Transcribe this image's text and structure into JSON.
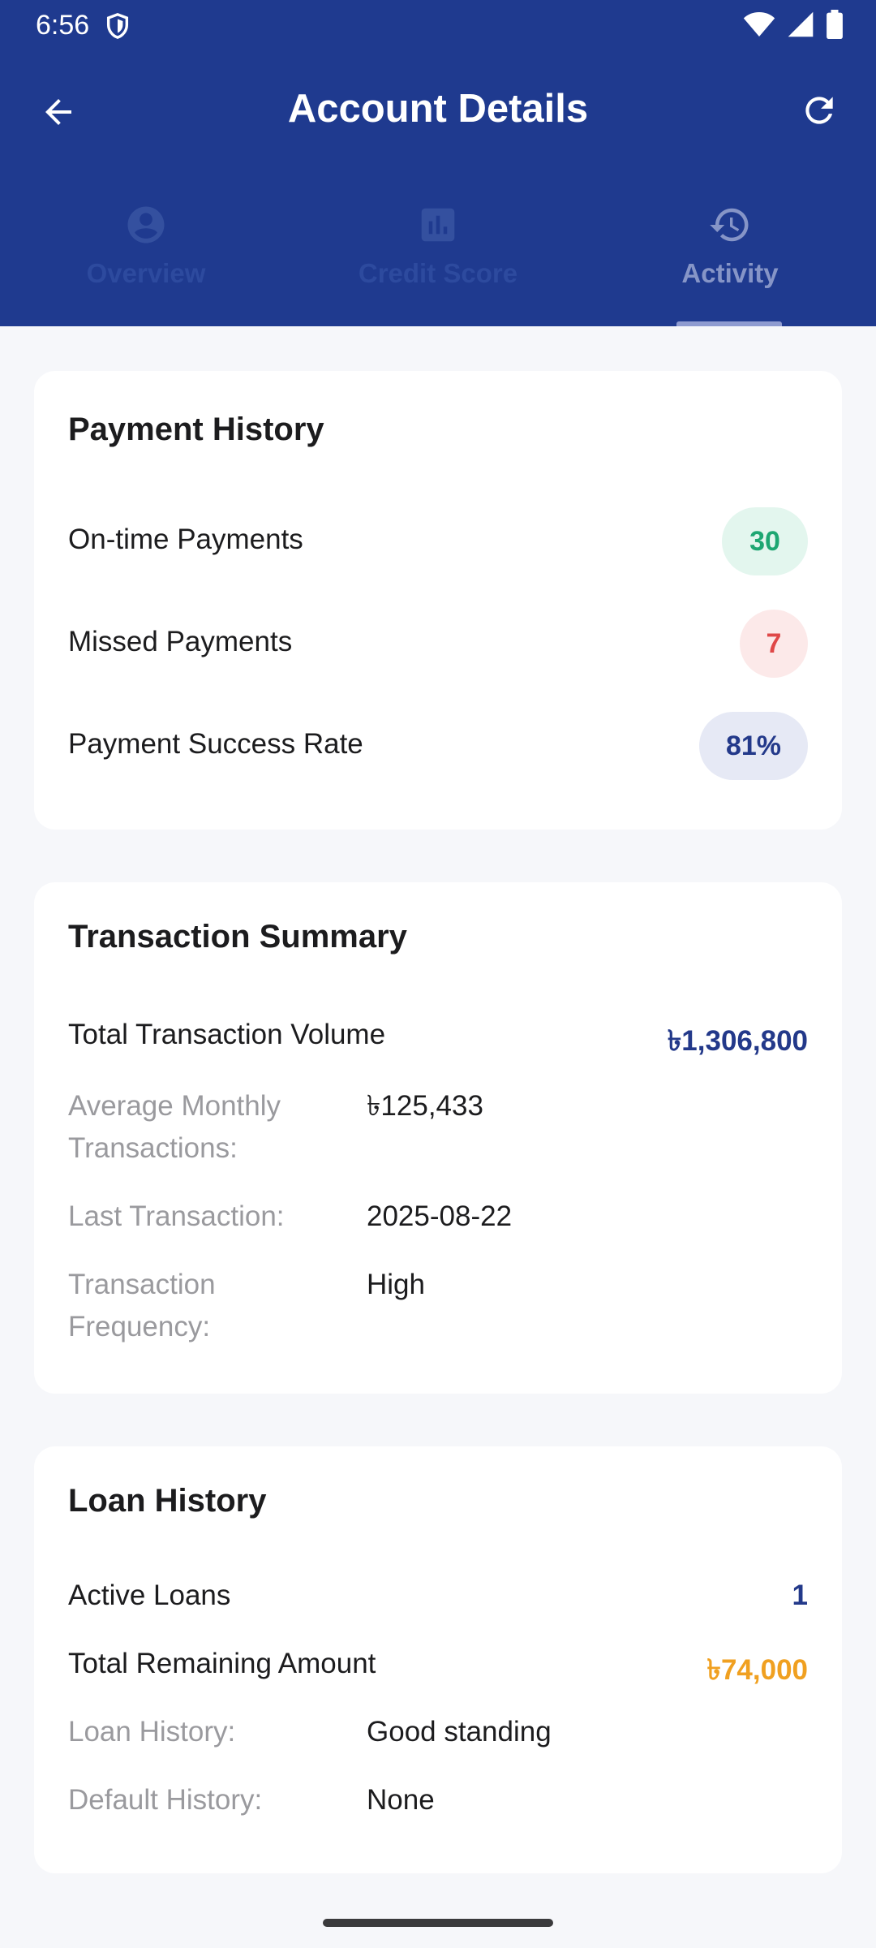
{
  "status_bar": {
    "time": "6:56",
    "icons": [
      "shield-icon",
      "wifi-icon",
      "signal-icon",
      "battery-icon"
    ]
  },
  "header": {
    "title": "Account Details",
    "back_icon": "arrow-back-icon",
    "refresh_icon": "refresh-icon",
    "background_color": "#1f3a8f"
  },
  "tabs": [
    {
      "label": "Overview",
      "icon": "account-circle-icon",
      "active": false
    },
    {
      "label": "Credit Score",
      "icon": "bar-chart-icon",
      "active": false
    },
    {
      "label": "Activity",
      "icon": "history-icon",
      "active": true
    }
  ],
  "payment_history": {
    "title": "Payment History",
    "rows": [
      {
        "label": "On-time Payments",
        "value": "30",
        "color": "#1ea672"
      },
      {
        "label": "Missed Payments",
        "value": "7",
        "color": "#df4848"
      },
      {
        "label": "Payment Success Rate",
        "value": "81%",
        "color": "#23398a"
      }
    ]
  },
  "transaction_summary": {
    "title": "Transaction Summary",
    "total_label": "Total Transaction Volume",
    "total_value": "৳1,306,800",
    "total_color": "#23398a",
    "details": [
      {
        "label": "Average Monthly Transactions:",
        "value": "৳125,433"
      },
      {
        "label": "Last Transaction:",
        "value": "2025-08-22"
      },
      {
        "label": "Transaction Frequency:",
        "value": "High"
      }
    ]
  },
  "loan_history": {
    "title": "Loan History",
    "active_label": "Active Loans",
    "active_value": "1",
    "active_color": "#23398a",
    "remaining_label": "Total Remaining Amount",
    "remaining_value": "৳74,000",
    "remaining_color": "#f0a020",
    "details": [
      {
        "label": "Loan History:",
        "value": "Good standing"
      },
      {
        "label": "Default History:",
        "value": "None"
      }
    ]
  }
}
